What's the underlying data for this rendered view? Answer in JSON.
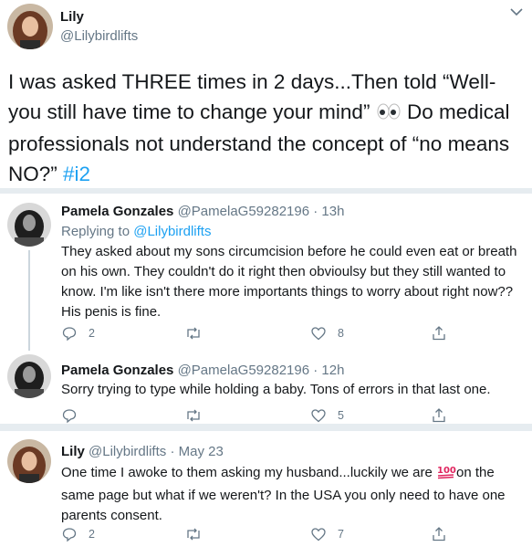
{
  "main_tweet": {
    "author_name": "Lily",
    "handle": "@Lilybirdlifts",
    "text_part1": "I was asked THREE times in 2 days...Then told “Well- you still have time to change your mind”",
    "text_part2": " Do medical professionals not understand the concept of “no means NO?” ",
    "hashtag": "#i2"
  },
  "replies": [
    {
      "author_name": "Pamela Gonzales",
      "handle": "@PamelaG59282196",
      "time": "· 13h",
      "replying_prefix": "Replying to ",
      "replying_handle": "@Lilybirdlifts",
      "text": "They asked about my sons circumcision before he could even eat or breath on his own. They couldn't do it right then obvioulsy but they still wanted to know. I'm like isn't there more importants things to worry about right now?? His penis is fine.",
      "reply_count": "2",
      "retweet_count": "",
      "like_count": "8"
    },
    {
      "author_name": "Pamela Gonzales",
      "handle": "@PamelaG59282196",
      "time": "· 12h",
      "text": "Sorry trying to type while holding a baby. Tons of errors in that last one.",
      "reply_count": "",
      "retweet_count": "",
      "like_count": "5"
    },
    {
      "author_name": "Lily",
      "handle": "@Lilybirdlifts",
      "time": "· May 23",
      "text_part1": "One time I awoke to them asking my husband...luckily we are ",
      "text_part2": "on the same page but what if we weren't? In the USA you only need to have one parents consent.",
      "reply_count": "2",
      "retweet_count": "",
      "like_count": "7"
    }
  ],
  "colors": {
    "link": "#1da1f2",
    "secondary_text": "#657786",
    "separator": "#e6ecf0"
  },
  "icons": [
    "chevron-down-icon",
    "eyes-emoji-icon",
    "hundred-points-emoji-icon",
    "reply-icon",
    "retweet-icon",
    "like-icon",
    "share-icon"
  ]
}
